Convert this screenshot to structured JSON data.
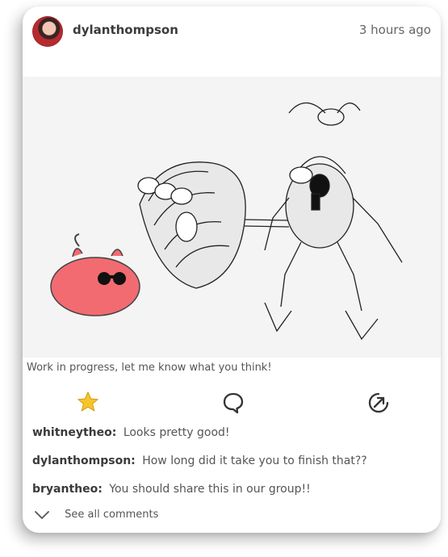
{
  "post": {
    "author": "dylanthompson",
    "time": "3 hours ago",
    "caption": "Work in progress, let me know what you think!"
  },
  "actions": {
    "favorite_icon": "star-icon",
    "comment_icon": "speech-bubble-icon",
    "share_icon": "share-arrow-icon",
    "accent": "#f7c52b"
  },
  "comments": [
    {
      "user": "whitneytheo:",
      "text": "Looks pretty good!"
    },
    {
      "user": "dylanthompson:",
      "text": "How long did it take you to finish that??"
    },
    {
      "user": "bryantheo:",
      "text": "You should share this in our group!!"
    }
  ],
  "footer": {
    "see_all": "See all comments"
  }
}
